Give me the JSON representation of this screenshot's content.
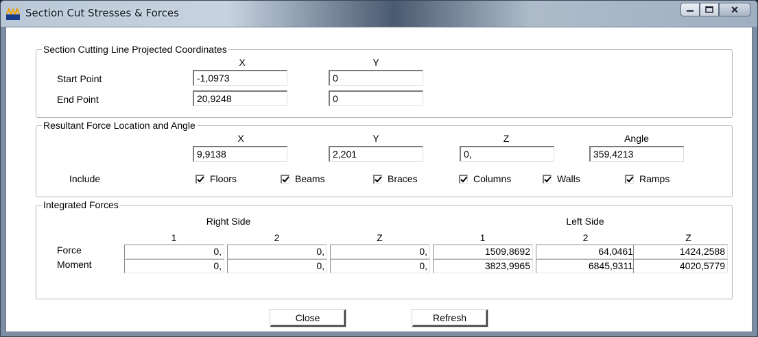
{
  "window": {
    "title": "Section Cut Stresses & Forces"
  },
  "section_cutting_line": {
    "legend": "Section Cutting Line Projected Coordinates",
    "col_x": "X",
    "col_y": "Y",
    "start_label": "Start Point",
    "start_x": "-1,0973",
    "start_y": "0",
    "end_label": "End Point",
    "end_x": "20,9248",
    "end_y": "0"
  },
  "resultant": {
    "legend": "Resultant Force Location and Angle",
    "col_x": "X",
    "col_y": "Y",
    "col_z": "Z",
    "col_angle": "Angle",
    "x": "9,9138",
    "y": "2,201",
    "z": "0,",
    "angle": "359,4213",
    "include_label": "Include",
    "include": {
      "floors": "Floors",
      "beams": "Beams",
      "braces": "Braces",
      "columns": "Columns",
      "walls": "Walls",
      "ramps": "Ramps"
    }
  },
  "integrated": {
    "legend": "Integrated Forces",
    "right_side": "Right Side",
    "left_side": "Left Side",
    "headers": [
      "1",
      "2",
      "Z",
      "1",
      "2",
      "Z"
    ],
    "force_label": "Force",
    "moment_label": "Moment",
    "force": [
      "0,",
      "0,",
      "0,",
      "1509,8692",
      "64,0461",
      "1424,2588"
    ],
    "moment": [
      "0,",
      "0,",
      "0,",
      "3823,9965",
      "6845,9311",
      "4020,5779"
    ]
  },
  "buttons": {
    "close": "Close",
    "refresh": "Refresh"
  },
  "colors": {
    "accent": "#3b6ea5",
    "checkmark": "#000000"
  },
  "icons": [
    "app-icon",
    "minimize-icon",
    "maximize-icon",
    "close-icon",
    "checkmark-icon"
  ]
}
